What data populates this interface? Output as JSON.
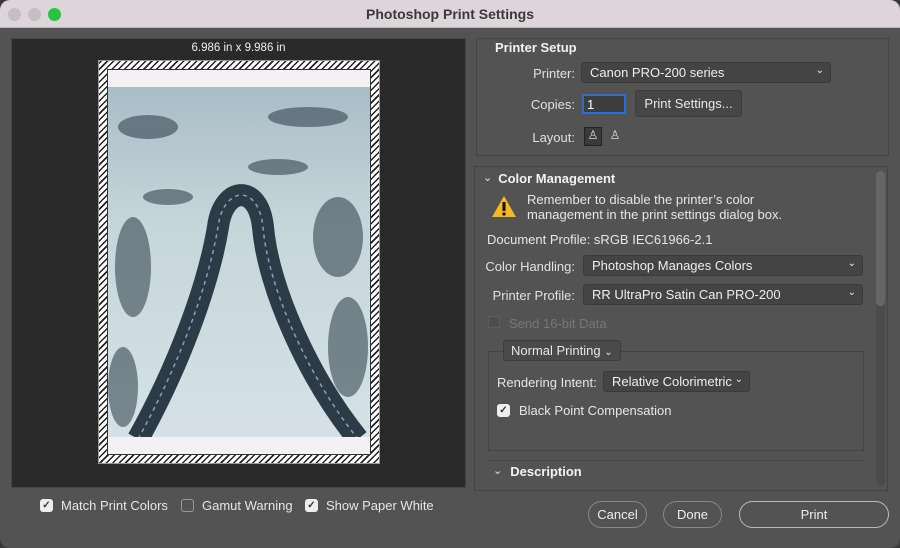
{
  "window": {
    "title": "Photoshop Print Settings"
  },
  "preview": {
    "dimensions": "6.986 in x 9.986 in"
  },
  "options": {
    "match_print_colors": {
      "label": "Match Print Colors",
      "checked": true
    },
    "gamut_warning": {
      "label": "Gamut Warning",
      "checked": false
    },
    "show_paper_white": {
      "label": "Show Paper White",
      "checked": true
    }
  },
  "printer_setup": {
    "heading": "Printer Setup",
    "printer_label": "Printer:",
    "printer_value": "Canon PRO-200 series",
    "copies_label": "Copies:",
    "copies_value": "1",
    "print_settings_label": "Print Settings...",
    "layout_label": "Layout:"
  },
  "color_management": {
    "heading": "Color Management",
    "warning": "Remember to disable the printer’s color management in the print settings dialog box.",
    "document_profile": "Document Profile: sRGB IEC61966-2.1",
    "color_handling_label": "Color Handling:",
    "color_handling_value": "Photoshop Manages Colors",
    "printer_profile_label": "Printer Profile:",
    "printer_profile_value": "RR UltraPro Satin Can PRO-200",
    "send16_label": "Send 16-bit Data",
    "normal_printing": "Normal Printing",
    "rendering_intent_label": "Rendering Intent:",
    "rendering_intent_value": "Relative Colorimetric",
    "bpc_label": "Black Point Compensation"
  },
  "description": {
    "heading": "Description"
  },
  "buttons": {
    "cancel": "Cancel",
    "done": "Done",
    "print": "Print"
  }
}
